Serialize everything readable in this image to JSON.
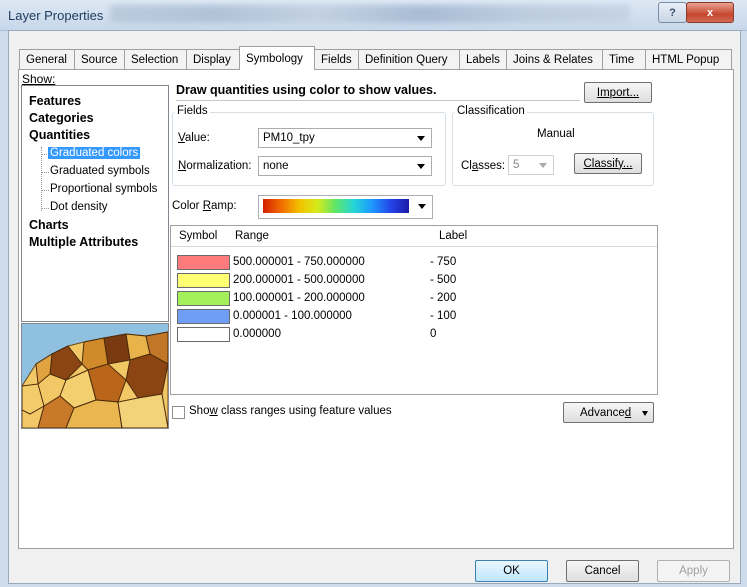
{
  "window": {
    "title": "Layer Properties",
    "help_label": "?",
    "close_label": "x"
  },
  "tabs": [
    "General",
    "Source",
    "Selection",
    "Display",
    "Symbology",
    "Fields",
    "Definition Query",
    "Labels",
    "Joins & Relates",
    "Time",
    "HTML Popup"
  ],
  "active_tab": "Symbology",
  "show": {
    "label": "Show:",
    "items": [
      "Features",
      "Categories",
      "Quantities",
      "Charts",
      "Multiple Attributes"
    ],
    "quantities_sub": [
      "Graduated colors",
      "Graduated symbols",
      "Proportional symbols",
      "Dot density"
    ],
    "selected": "Graduated colors"
  },
  "main": {
    "heading": "Draw quantities using color to show values.",
    "import_label": "Import...",
    "fields_group": "Fields",
    "value_label": "Value:",
    "value": "PM10_tpy",
    "normalization_label": "Normalization:",
    "normalization": "none",
    "classification_group": "Classification",
    "classification_method": "Manual",
    "classes_label": "Classes:",
    "classes_value": "5",
    "classify_label": "Classify...",
    "color_ramp_label": "Color Ramp:"
  },
  "table": {
    "headers": {
      "symbol": "Symbol",
      "range": "Range",
      "label": "Label"
    },
    "rows": [
      {
        "color": "#ff7a7a",
        "range": "500.000001 - 750.000000",
        "label": "- 750"
      },
      {
        "color": "#ffff73",
        "range": "200.000001 - 500.000000",
        "label": "- 500"
      },
      {
        "color": "#a3f05a",
        "range": "100.000001 - 200.000000",
        "label": "- 200"
      },
      {
        "color": "#6e9ef5",
        "range": "0.000001 - 100.000000",
        "label": "- 100"
      },
      {
        "color": "#ffffff",
        "range": "0.000000",
        "label": "0"
      }
    ]
  },
  "options": {
    "show_class_ranges_label": "Show class ranges using feature values",
    "show_class_ranges_checked": false,
    "advanced_label": "Advanced"
  },
  "footer": {
    "ok": "OK",
    "cancel": "Cancel",
    "apply": "Apply"
  }
}
